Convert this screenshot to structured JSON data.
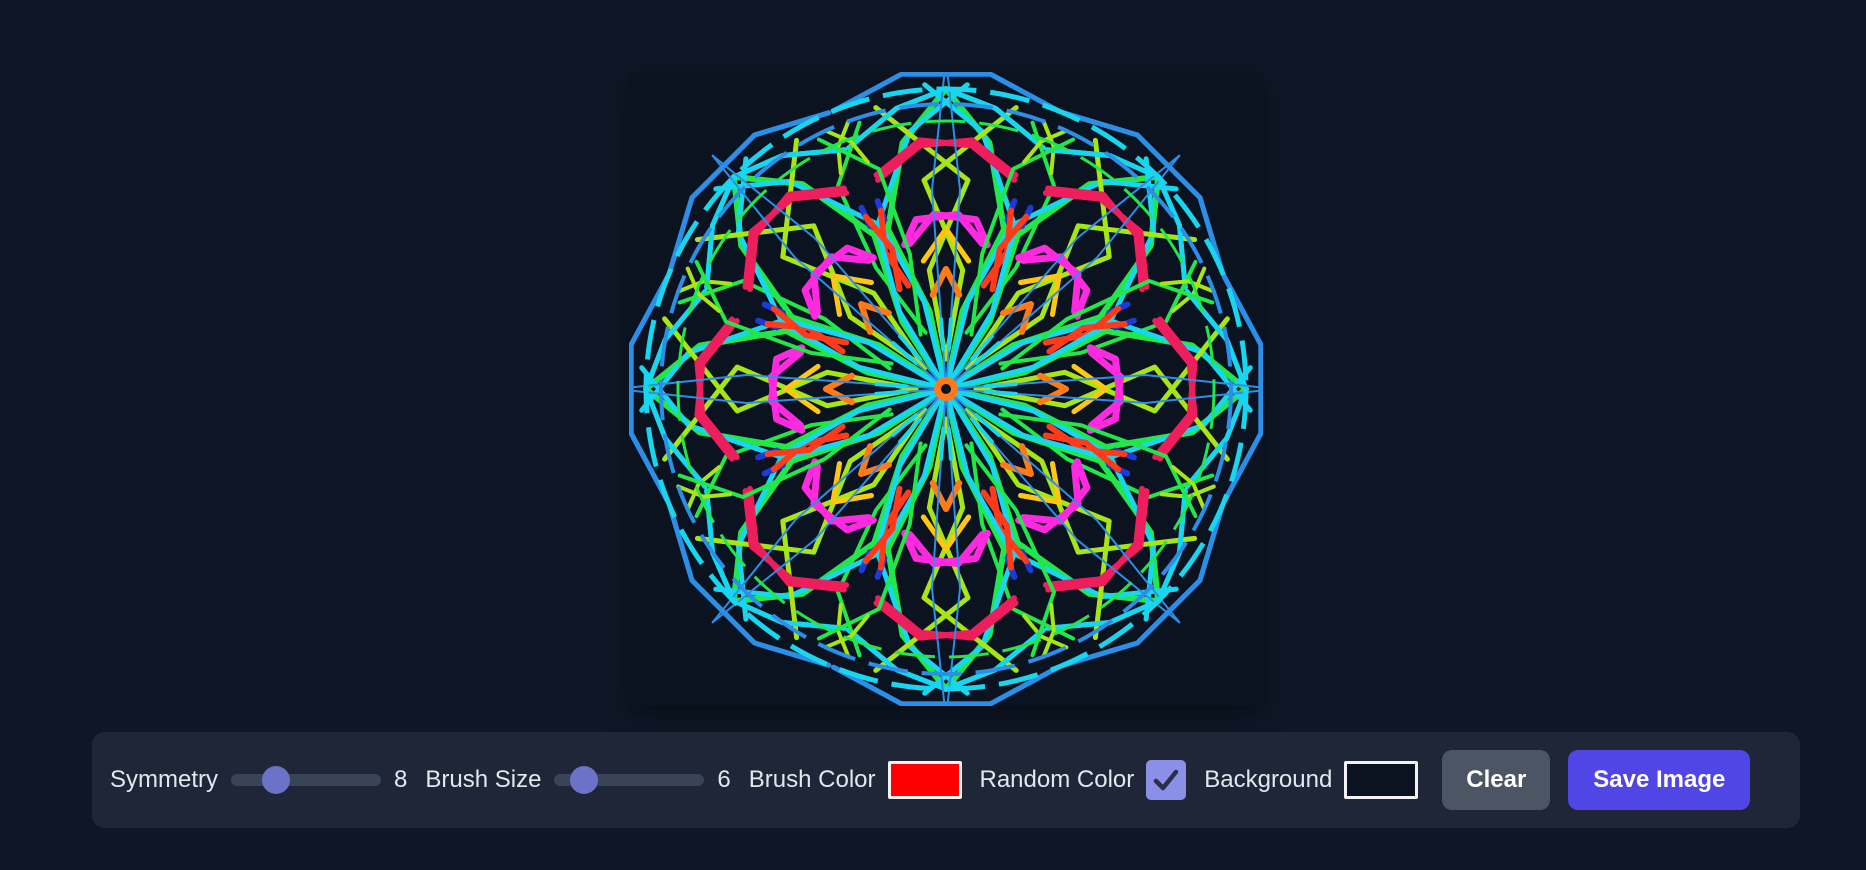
{
  "toolbar": {
    "symmetry_label": "Symmetry",
    "symmetry_value": "8",
    "symmetry_fraction": 0.3,
    "brush_size_label": "Brush Size",
    "brush_size_value": "6",
    "brush_size_fraction": 0.2,
    "brush_color_label": "Brush Color",
    "brush_color": "#ff0000",
    "random_color_label": "Random Color",
    "random_color_checked": true,
    "background_label": "Background",
    "background_color": "#0b1220",
    "clear_label": "Clear",
    "save_label": "Save Image"
  },
  "colors": {
    "page_bg": "#0f1727",
    "canvas_bg": "#0b1220",
    "toolbar_bg": "#1e2637",
    "slider_thumb": "#6b72c8",
    "checkbox_accent": "#8c8fe8",
    "clear_button": "#4b5563",
    "save_button": "#4f46e5"
  },
  "canvas": {
    "symmetry": 8,
    "stroke_colors": [
      "#18d6ee",
      "#2b8fe8",
      "#22e64a",
      "#a6e617",
      "#ee1e5c",
      "#ff2ae0",
      "#ffc612",
      "#ff7a18",
      "#1d3ad8",
      "#ff3b1c"
    ]
  }
}
